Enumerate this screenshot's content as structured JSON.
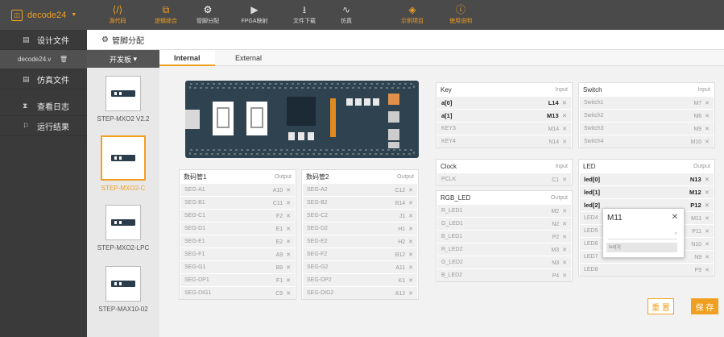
{
  "app": {
    "title": "decode24"
  },
  "toolbar": [
    {
      "label": "源代码",
      "icon": "code-icon",
      "class": "hl"
    },
    {
      "label": "逻辑综合",
      "icon": "synthesis-icon",
      "class": "hl"
    },
    {
      "label": "管脚分配",
      "icon": "gear-icon",
      "class": "plain active"
    },
    {
      "label": "FPGA映射",
      "icon": "play-icon",
      "class": "plain"
    },
    {
      "label": "文件下载",
      "icon": "download-icon",
      "class": "plain"
    },
    {
      "label": "仿真",
      "icon": "waveform-icon",
      "class": "plain"
    },
    {
      "label": "示例项目",
      "icon": "diamond-icon",
      "class": "hl"
    },
    {
      "label": "使用说明",
      "icon": "alert-icon",
      "class": "hl"
    }
  ],
  "sidebar": {
    "design_files": "设计文件",
    "file_name": "decode24.v",
    "sim_files": "仿真文件",
    "logs": "查看日志",
    "results": "运行结果"
  },
  "header": {
    "title": "管脚分配"
  },
  "boards_header": "开发板",
  "boards": [
    {
      "name": "STEP-MXO2 V2.2",
      "selected": false
    },
    {
      "name": "STEP-MXO2-C",
      "selected": true
    },
    {
      "name": "STEP-MXO2-LPC",
      "selected": false
    },
    {
      "name": "STEP-MAX10-02",
      "selected": false
    }
  ],
  "tabs": {
    "internal": "Internal",
    "external": "External"
  },
  "panels": {
    "key": {
      "title": "Key",
      "out": "Input",
      "rows": [
        {
          "name": "a[0]",
          "pin": "L14",
          "bold": true
        },
        {
          "name": "a[1]",
          "pin": "M13",
          "bold": true
        },
        {
          "name": "KEY3",
          "pin": "M14",
          "bold": false
        },
        {
          "name": "KEY4",
          "pin": "N14",
          "bold": false
        }
      ]
    },
    "switch": {
      "title": "Switch",
      "out": "Input",
      "rows": [
        {
          "name": "Switch1",
          "pin": "M7",
          "bold": false
        },
        {
          "name": "Switch2",
          "pin": "M8",
          "bold": false
        },
        {
          "name": "Switch3",
          "pin": "M9",
          "bold": false
        },
        {
          "name": "Switch4",
          "pin": "M10",
          "bold": false
        }
      ]
    },
    "clock": {
      "title": "Clock",
      "out": "Input",
      "rows": [
        {
          "name": "PCLK",
          "pin": "C1",
          "bold": false
        }
      ]
    },
    "rgb": {
      "title": "RGB_LED",
      "out": "Output",
      "rows": [
        {
          "name": "R_LED1",
          "pin": "M2",
          "bold": false
        },
        {
          "name": "G_LED1",
          "pin": "N2",
          "bold": false
        },
        {
          "name": "B_LED1",
          "pin": "P2",
          "bold": false
        },
        {
          "name": "R_LED2",
          "pin": "M3",
          "bold": false
        },
        {
          "name": "G_LED2",
          "pin": "N3",
          "bold": false
        },
        {
          "name": "B_LED2",
          "pin": "P4",
          "bold": false
        }
      ]
    },
    "led": {
      "title": "LED",
      "out": "Output",
      "rows": [
        {
          "name": "led[0]",
          "pin": "N13",
          "bold": true
        },
        {
          "name": "led[1]",
          "pin": "M12",
          "bold": true
        },
        {
          "name": "led[2]",
          "pin": "P12",
          "bold": true
        },
        {
          "name": "LED4",
          "pin": "M11",
          "bold": false
        },
        {
          "name": "LED5",
          "pin": "P11",
          "bold": false
        },
        {
          "name": "LED6",
          "pin": "N10",
          "bold": false
        },
        {
          "name": "LED7",
          "pin": "N9",
          "bold": false
        },
        {
          "name": "LED8",
          "pin": "P9",
          "bold": false
        }
      ]
    },
    "seg1": {
      "title": "数码管1",
      "out": "Output",
      "rows": [
        {
          "name": "SEG-A1",
          "pin": "A10",
          "bold": false
        },
        {
          "name": "SEG-B1",
          "pin": "C11",
          "bold": false
        },
        {
          "name": "SEG-C1",
          "pin": "F2",
          "bold": false
        },
        {
          "name": "SEG-D1",
          "pin": "E1",
          "bold": false
        },
        {
          "name": "SEG-E1",
          "pin": "E2",
          "bold": false
        },
        {
          "name": "SEG-F1",
          "pin": "A9",
          "bold": false
        },
        {
          "name": "SEG-G1",
          "pin": "B9",
          "bold": false
        },
        {
          "name": "SEG-DP1",
          "pin": "F1",
          "bold": false
        },
        {
          "name": "SEG-DIG1",
          "pin": "C9",
          "bold": false
        }
      ]
    },
    "seg2": {
      "title": "数码管2",
      "out": "Output",
      "rows": [
        {
          "name": "SEG-A2",
          "pin": "C12",
          "bold": false
        },
        {
          "name": "SEG-B2",
          "pin": "B14",
          "bold": false
        },
        {
          "name": "SEG-C2",
          "pin": "J1",
          "bold": false
        },
        {
          "name": "SEG-D2",
          "pin": "H1",
          "bold": false
        },
        {
          "name": "SEG-E2",
          "pin": "H2",
          "bold": false
        },
        {
          "name": "SEG-F2",
          "pin": "B12",
          "bold": false
        },
        {
          "name": "SEG-G2",
          "pin": "A11",
          "bold": false
        },
        {
          "name": "SEG-DP2",
          "pin": "K1",
          "bold": false
        },
        {
          "name": "SEG-DIG2",
          "pin": "A12",
          "bold": false
        }
      ]
    }
  },
  "popup": {
    "title": "M11",
    "option": "led[3]"
  },
  "buttons": {
    "reset": "重 置",
    "save": "保 存"
  },
  "colors": {
    "accent": "#f0a020",
    "topbar": "#4a4a4a",
    "sidebar": "#3a3a3a"
  }
}
